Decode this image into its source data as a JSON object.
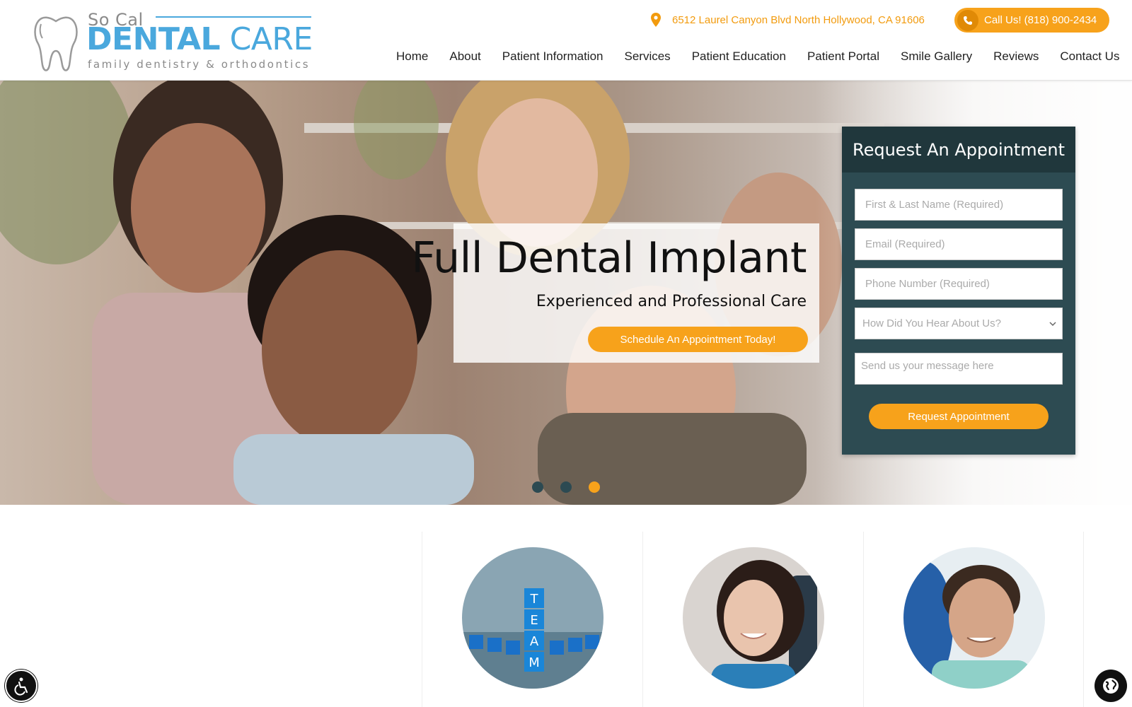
{
  "logo": {
    "small_text": "So Cal",
    "brand_bold": "DENTAL",
    "brand_light": " CARE",
    "tagline": "family dentistry & orthodontics"
  },
  "header": {
    "address": "6512 Laurel Canyon Blvd North Hollywood, CA 91606",
    "call_label": "Call Us! (818) 900-2434",
    "accent_color": "#f7a21b"
  },
  "nav": {
    "items": [
      {
        "label": "Home"
      },
      {
        "label": "About"
      },
      {
        "label": "Patient Information"
      },
      {
        "label": "Services"
      },
      {
        "label": "Patient Education"
      },
      {
        "label": "Patient Portal"
      },
      {
        "label": "Smile Gallery"
      },
      {
        "label": "Reviews"
      },
      {
        "label": "Contact Us"
      }
    ]
  },
  "hero": {
    "title": "Full Dental Implant",
    "subtitle": "Experienced and Professional Care",
    "cta_label": "Schedule An Appointment Today!",
    "slide_count": 3,
    "active_slide": 3
  },
  "appointment_form": {
    "heading": "Request An Appointment",
    "name_placeholder": "First & Last Name (Required)",
    "email_placeholder": "Email (Required)",
    "phone_placeholder": "Phone Number (Required)",
    "source_selected": "How Did You Hear About Us?",
    "message_placeholder": "Send us your message here",
    "submit_label": "Request Appointment",
    "panel_color": "#2d4b52",
    "heading_bg_color": "#20373c"
  },
  "icons": {
    "address": "map-pin-icon",
    "call": "phone-icon",
    "select": "chevron-down-icon",
    "accessibility": "accessibility-icon",
    "language": "globe-icon"
  }
}
